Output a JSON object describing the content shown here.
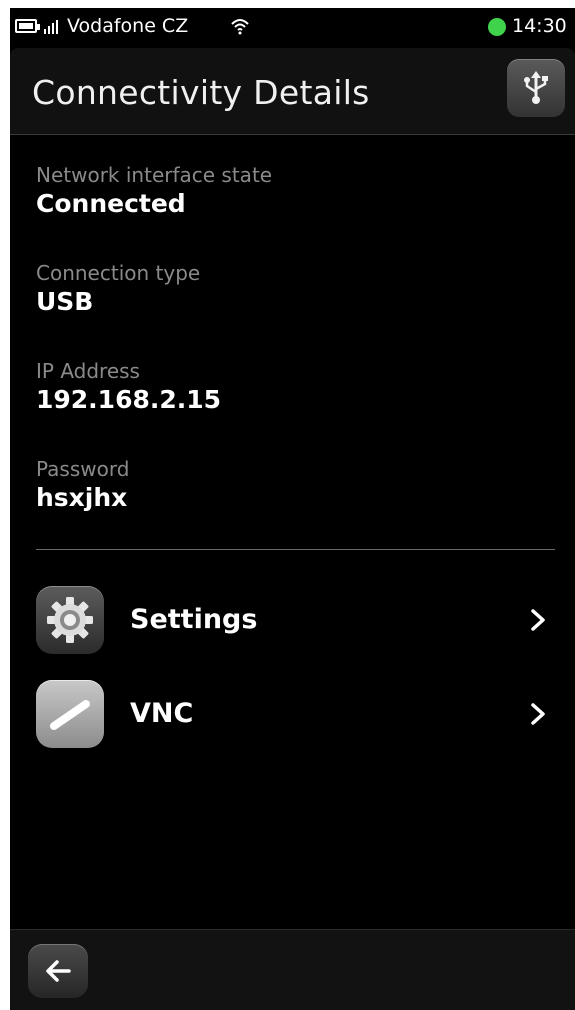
{
  "status_bar": {
    "carrier": "Vodafone CZ",
    "time": "14:30",
    "indicator_color": "#3fd34b"
  },
  "header": {
    "title": "Connectivity Details",
    "action_icon": "usb-icon"
  },
  "details": [
    {
      "label": "Network interface state",
      "value": "Connected"
    },
    {
      "label": "Connection type",
      "value": "USB"
    },
    {
      "label": "IP Address",
      "value": "192.168.2.15"
    },
    {
      "label": "Password",
      "value": "hsxjhx"
    }
  ],
  "menu": [
    {
      "label": "Settings",
      "icon": "gear-icon"
    },
    {
      "label": "VNC",
      "icon": "vnc-icon"
    }
  ],
  "toolbar": {
    "back_icon": "back-arrow-icon"
  }
}
